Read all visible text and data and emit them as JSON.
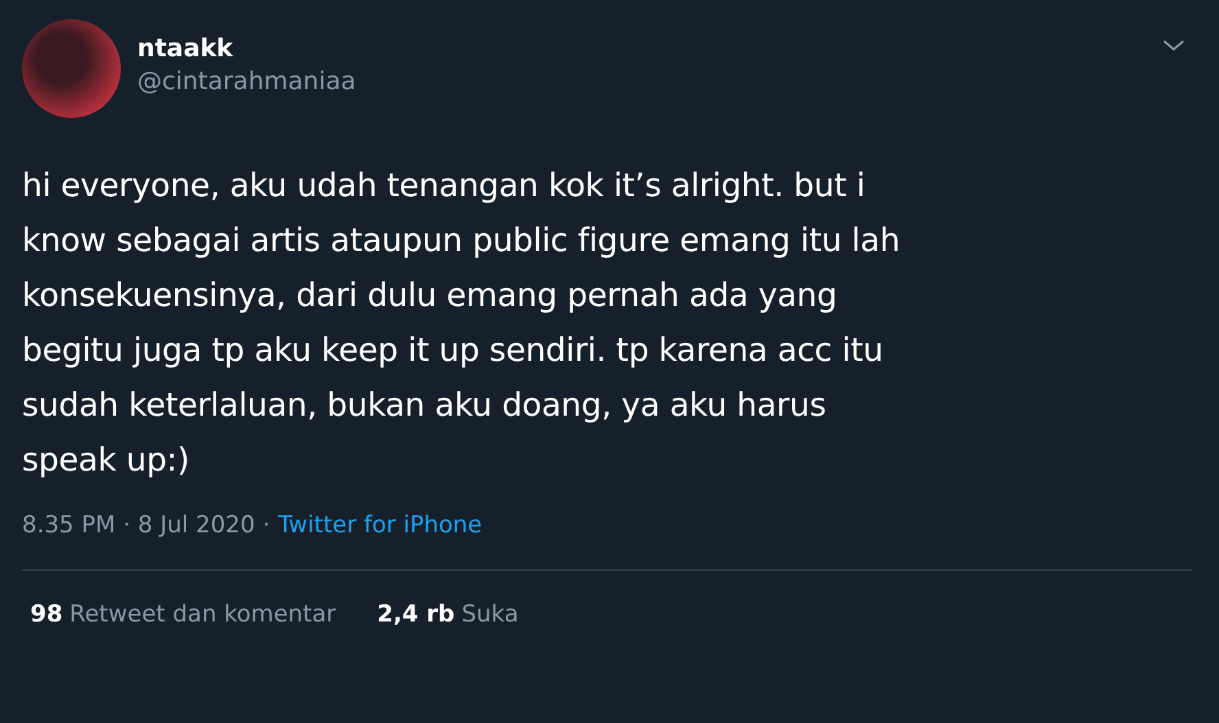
{
  "author": {
    "name": "ntaakk",
    "handle": "@cintarahmaniaa"
  },
  "tweet_lines": [
    "hi everyone, aku udah tenangan kok it’s alright. but i",
    "know sebagai artis ataupun public figure emang itu lah",
    "konsekuensinya, dari dulu emang pernah ada yang",
    "begitu juga tp aku keep it up sendiri. tp karena acc itu",
    "sudah keterlaluan, bukan aku doang, ya aku harus",
    "speak up:)"
  ],
  "meta": {
    "time": "8.35 PM · 8 Jul 2020 ·",
    "source": "Twitter for iPhone"
  },
  "stats": [
    {
      "count": "98",
      "label": "Retweet dan komentar"
    },
    {
      "count": "2,4 rb",
      "label": "Suka"
    }
  ]
}
